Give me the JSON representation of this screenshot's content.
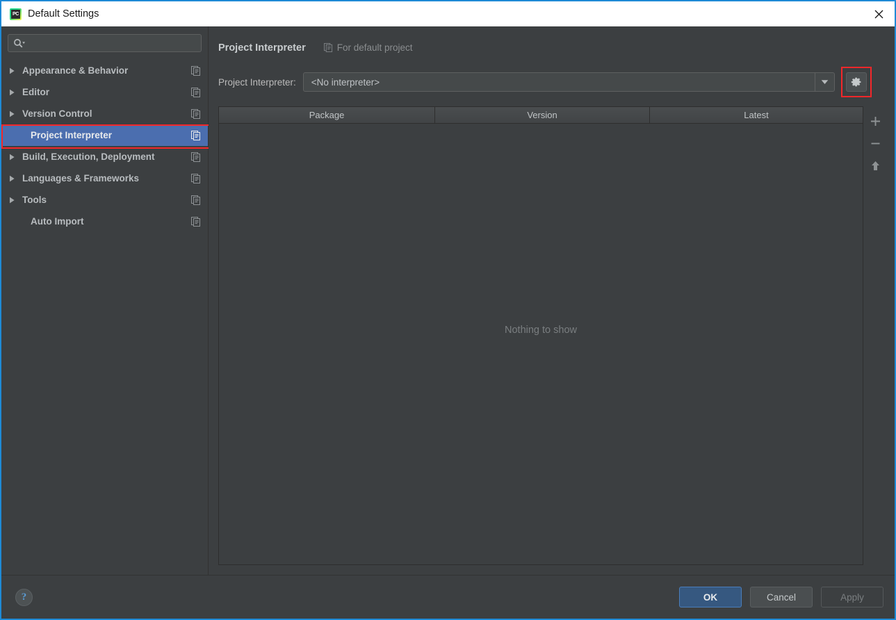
{
  "window": {
    "title": "Default Settings",
    "app_icon": "pycharm-icon",
    "icon_text": "PC",
    "close_label": "✕",
    "border_color": "#1e8ad6"
  },
  "search": {
    "value": "",
    "placeholder": "",
    "icon": "search-icon"
  },
  "sidebar": {
    "items": [
      {
        "label": "Appearance & Behavior",
        "expandable": true,
        "selected": false,
        "trailing_icon": "copy-settings-icon"
      },
      {
        "label": "Editor",
        "expandable": true,
        "selected": false,
        "trailing_icon": "copy-settings-icon"
      },
      {
        "label": "Version Control",
        "expandable": true,
        "selected": false,
        "trailing_icon": "copy-settings-icon"
      },
      {
        "label": "Project Interpreter",
        "expandable": false,
        "selected": true,
        "trailing_icon": "copy-settings-icon"
      },
      {
        "label": "Build, Execution, Deployment",
        "expandable": true,
        "selected": false,
        "trailing_icon": "copy-settings-icon"
      },
      {
        "label": "Languages & Frameworks",
        "expandable": true,
        "selected": false,
        "trailing_icon": "copy-settings-icon"
      },
      {
        "label": "Tools",
        "expandable": true,
        "selected": false,
        "trailing_icon": "copy-settings-icon"
      },
      {
        "label": "Auto Import",
        "expandable": false,
        "selected": false,
        "trailing_icon": "copy-settings-icon"
      }
    ],
    "selected_highlight_color": "#4b6eaf",
    "annotation_color": "#f4272a"
  },
  "content": {
    "page_title": "Project Interpreter",
    "subtitle": "For default project",
    "subtitle_icon": "copy-settings-icon",
    "interpreter": {
      "label": "Project Interpreter:",
      "value": "<No interpreter>",
      "dropdown_icon": "chevron-down-icon",
      "gear_icon": "gear-icon",
      "gear_annotated": true
    },
    "packages_table": {
      "columns": [
        "Package",
        "Version",
        "Latest"
      ],
      "rows": [],
      "empty_text": "Nothing to show"
    },
    "table_tools": [
      {
        "name": "add-package-button",
        "glyph": "+"
      },
      {
        "name": "remove-package-button",
        "glyph": "−"
      },
      {
        "name": "upgrade-package-button",
        "glyph": "↑"
      }
    ]
  },
  "footer": {
    "help_label": "?",
    "ok_label": "OK",
    "cancel_label": "Cancel",
    "apply_label": "Apply",
    "apply_enabled": false,
    "ok_color": "#365880"
  }
}
